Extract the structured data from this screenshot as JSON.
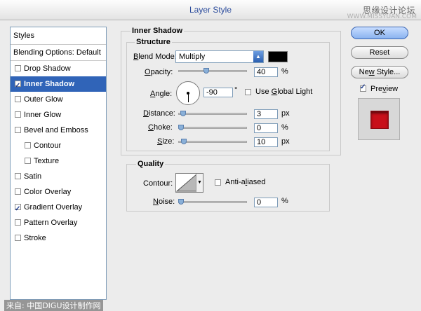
{
  "window": {
    "title": "Layer Style"
  },
  "watermark": {
    "top": "思缘设计论坛",
    "top_sub": "WWW.MISSYUAN.COM",
    "bottom": "来自: 中国DIGU设计制作网"
  },
  "styles_panel": {
    "header": "Styles",
    "blending": "Blending Options: Default",
    "items": [
      {
        "label": "Drop Shadow",
        "checked": false
      },
      {
        "label": "Inner Shadow",
        "checked": true,
        "selected": true
      },
      {
        "label": "Outer Glow",
        "checked": false
      },
      {
        "label": "Inner Glow",
        "checked": false
      },
      {
        "label": "Bevel and Emboss",
        "checked": false
      },
      {
        "label": "Contour",
        "checked": false,
        "indent": true
      },
      {
        "label": "Texture",
        "checked": false,
        "indent": true
      },
      {
        "label": "Satin",
        "checked": false
      },
      {
        "label": "Color Overlay",
        "checked": false
      },
      {
        "label": "Gradient Overlay",
        "checked": true
      },
      {
        "label": "Pattern Overlay",
        "checked": false
      },
      {
        "label": "Stroke",
        "checked": false
      }
    ]
  },
  "inner_shadow": {
    "section_title": "Inner Shadow",
    "structure_title": "Structure",
    "blend_mode": {
      "label_pre": "B",
      "label_post": "lend Mode:",
      "value": "Multiply",
      "color": "#000000"
    },
    "opacity": {
      "label_pre": "O",
      "label_post": "pacity:",
      "value": "40",
      "unit": "%",
      "level": 0.4
    },
    "angle": {
      "label_pre": "A",
      "label_post": "ngle:",
      "value": "-90",
      "unit": "°",
      "global_light_pre": "Use ",
      "global_light_acc": "G",
      "global_light_post": "lobal Light",
      "global_light_checked": false
    },
    "distance": {
      "label_pre": "D",
      "label_post": "istance:",
      "value": "3",
      "unit": "px",
      "level": 0.03
    },
    "choke": {
      "label_pre": "C",
      "label_post": "hoke:",
      "value": "0",
      "unit": "%",
      "level": 0
    },
    "size": {
      "label_pre": "S",
      "label_post": "ize:",
      "value": "10",
      "unit": "px",
      "level": 0.04
    }
  },
  "quality": {
    "title": "Quality",
    "contour_label": "Contour:",
    "anti_aliased_pre": "Anti-a",
    "anti_aliased_acc": "l",
    "anti_aliased_post": "iased",
    "anti_aliased_checked": false,
    "noise": {
      "label_pre": "N",
      "label_post": "oise:",
      "value": "0",
      "unit": "%",
      "level": 0
    }
  },
  "buttons": {
    "ok": "OK",
    "reset": "Reset",
    "new_style_pre": "Ne",
    "new_style_acc": "w",
    "new_style_post": " Style...",
    "preview_label_pre": "Pre",
    "preview_label_acc": "v",
    "preview_label_post": "iew",
    "preview_checked": true
  },
  "colors": {
    "accent": "#3064b8",
    "preview": "#c8101a"
  }
}
